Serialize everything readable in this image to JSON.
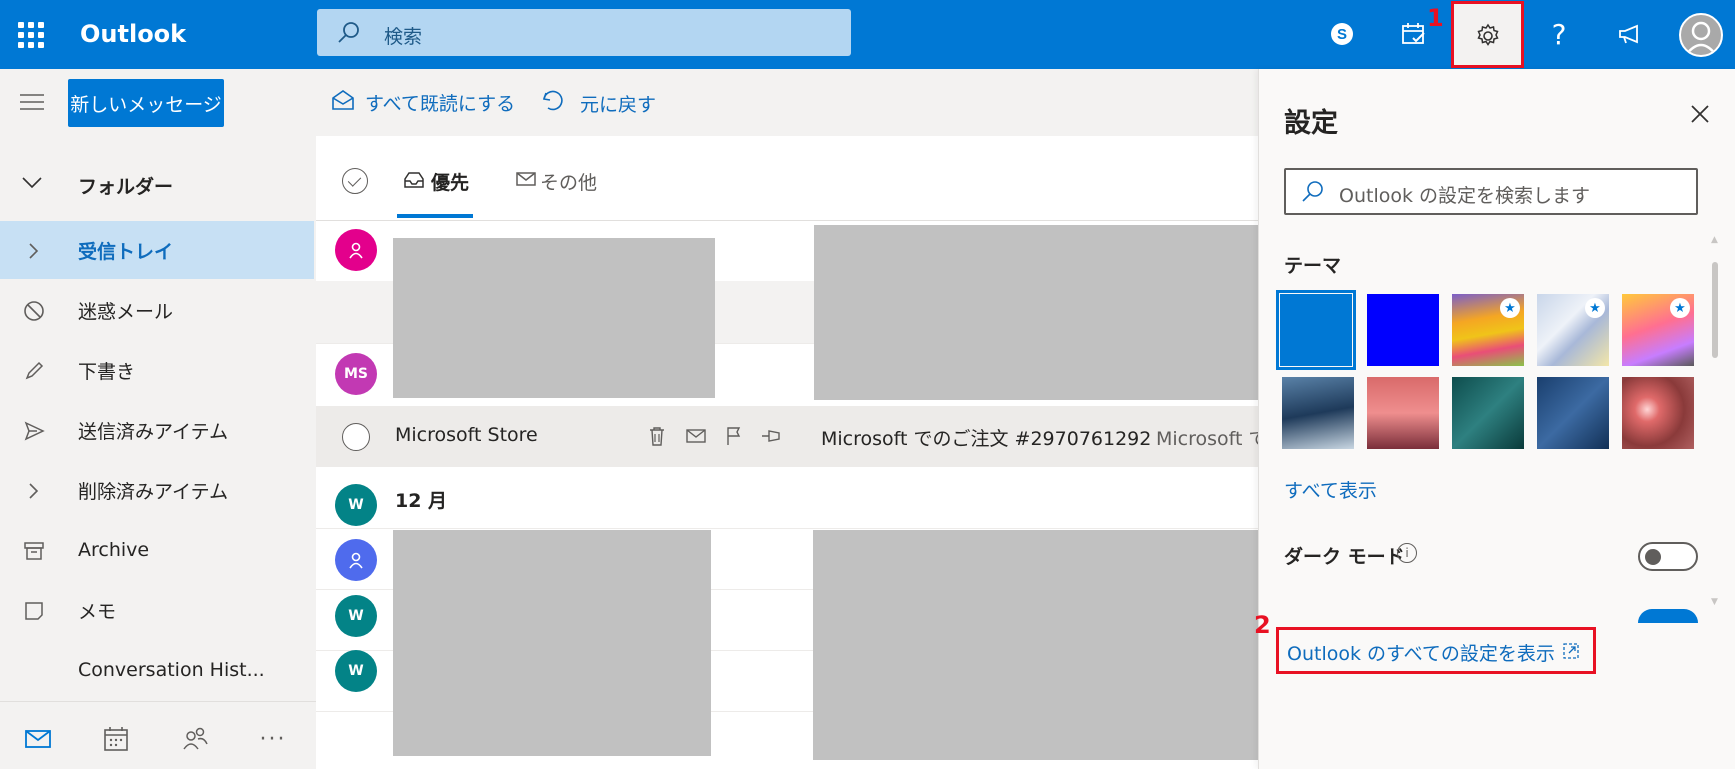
{
  "app": {
    "name": "Outlook"
  },
  "search": {
    "placeholder": "検索"
  },
  "annotations": {
    "step1": "1",
    "step2": "2",
    "color": "#e81123"
  },
  "colors": {
    "accent": "#0078d4",
    "nav_selected": "#c7e0f4",
    "link": "#0f6cbd"
  },
  "topbar_icons": [
    "app-launcher-icon",
    "skype-icon",
    "my-day-icon",
    "settings-gear-icon",
    "help-icon",
    "feedback-megaphone-icon",
    "account-avatar-icon"
  ],
  "nav": {
    "new_message": "新しいメッセージ",
    "folders_header": "フォルダー",
    "items": [
      {
        "label": "受信トレイ",
        "icon": "chevron-right-icon",
        "selected": true
      },
      {
        "label": "迷惑メール",
        "icon": "blocked-icon"
      },
      {
        "label": "下書き",
        "icon": "pencil-icon"
      },
      {
        "label": "送信済みアイテム",
        "icon": "send-icon"
      },
      {
        "label": "削除済みアイテム",
        "icon": "chevron-right-icon"
      },
      {
        "label": "Archive",
        "icon": "archive-icon"
      },
      {
        "label": "メモ",
        "icon": "note-icon"
      },
      {
        "label": "Conversation Hist...",
        "icon": ""
      }
    ],
    "bottom": [
      "mail-icon",
      "calendar-icon",
      "people-icon",
      "more-icon"
    ]
  },
  "toolbar": {
    "mark_all_read": "すべて既読にする",
    "undo": "元に戻す"
  },
  "tabs": {
    "focused": "優先",
    "other": "その他"
  },
  "messages": {
    "avatars": [
      "",
      "MS",
      "W",
      "",
      "W",
      "W"
    ],
    "selected_row": {
      "sender": "Microsoft Store",
      "subject": "Microsoft でのご注文 #2970761292",
      "preview": "Microsoft で"
    },
    "month_header": "12 月"
  },
  "settings": {
    "title": "設定",
    "search_placeholder": "Outlook の設定を検索します",
    "theme_label": "テーマ",
    "show_all": "すべて表示",
    "dark_mode_label": "ダーク モード",
    "dark_mode_on": false,
    "view_all": "Outlook のすべての設定を表示"
  }
}
